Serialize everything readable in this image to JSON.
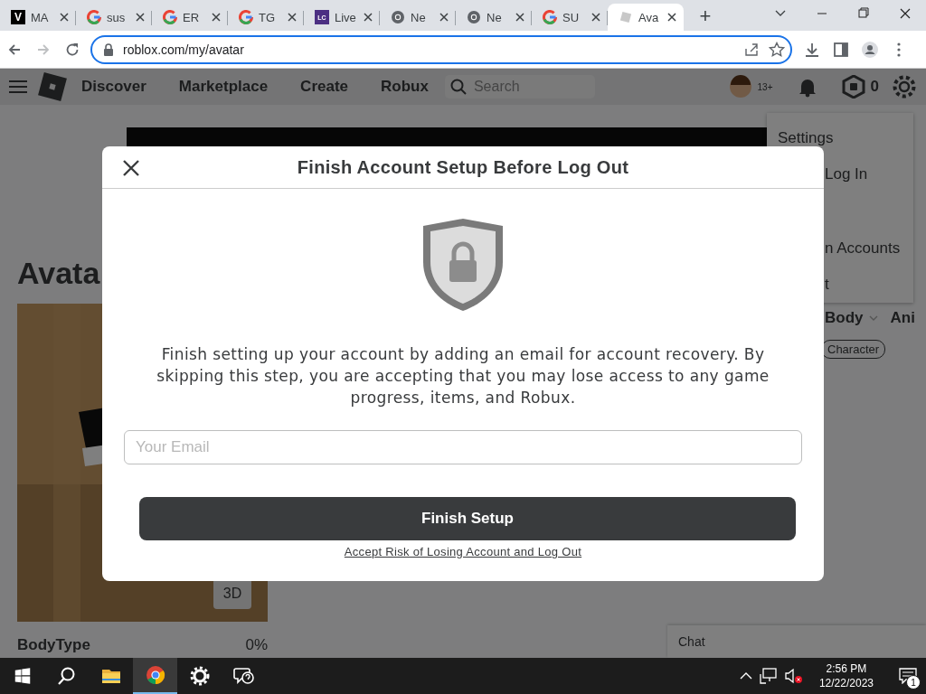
{
  "browser": {
    "tabs": [
      {
        "kind": "v",
        "icon_text": "V",
        "title": "MA",
        "selected": false
      },
      {
        "kind": "google",
        "title": "sus",
        "selected": false
      },
      {
        "kind": "google",
        "title": "ER",
        "selected": false
      },
      {
        "kind": "google",
        "title": "TG",
        "selected": false
      },
      {
        "kind": "lc",
        "icon_text": "LC",
        "title": "Live",
        "selected": false
      },
      {
        "kind": "chrome",
        "title": "Ne",
        "selected": false
      },
      {
        "kind": "chrome",
        "title": "Ne",
        "selected": false
      },
      {
        "kind": "google",
        "title": "SU",
        "selected": false
      },
      {
        "kind": "roblox",
        "title": "Ava",
        "selected": true
      }
    ],
    "new_tab": "+",
    "back_disabled": false,
    "forward_disabled": true,
    "url": "roblox.com/my/avatar"
  },
  "nav": {
    "items": [
      "Discover",
      "Marketplace",
      "Create",
      "Robux"
    ],
    "search": {
      "placeholder": "Search"
    },
    "age_badge": "13+",
    "robux": "0"
  },
  "settings_menu": {
    "items": [
      "Settings",
      "Log In",
      "n Accounts",
      "t"
    ]
  },
  "page": {
    "heading": "Avata",
    "view_button": "3D",
    "body_type": {
      "label": "BodyType",
      "value": "0%"
    },
    "tabs": [
      "Body",
      "Ani"
    ],
    "chip": "Character",
    "chat": "Chat"
  },
  "modal": {
    "title": "Finish Account Setup Before Log Out",
    "message": "Finish setting up your account by adding an email for account recovery. By skipping this step, you are accepting that you may lose access to any game progress, items, and Robux.",
    "email": {
      "placeholder": "Your Email"
    },
    "primary_button": "Finish Setup",
    "link": "Accept Risk of Losing Account and Log Out"
  },
  "taskbar": {
    "apps": [
      {
        "kind": "search",
        "active": false
      },
      {
        "kind": "folder",
        "active": false
      },
      {
        "kind": "chrome",
        "active": true
      },
      {
        "kind": "settings",
        "active": false
      },
      {
        "kind": "help",
        "active": false
      }
    ],
    "time": "2:56 PM",
    "date": "12/22/2023",
    "notifications": "1"
  }
}
